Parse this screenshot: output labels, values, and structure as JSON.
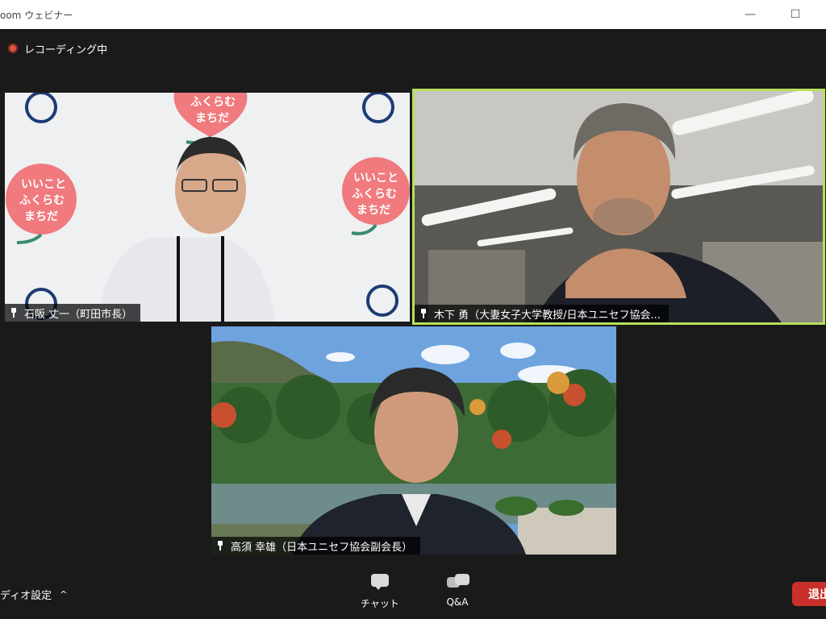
{
  "window": {
    "title": "oom ウェビナー",
    "minimize": "—",
    "maximize": "☐"
  },
  "recording": {
    "label": "レコーディング中"
  },
  "participants": [
    {
      "name": "石阪 丈一（町田市長）"
    },
    {
      "name": "木下 勇（大妻女子大学教授/日本ユニセフ協会..."
    },
    {
      "name": "高須 幸雄（日本ユニセフ協会副会長）"
    }
  ],
  "backdrop": {
    "slogan_line1": "いいこと",
    "slogan_line2": "ふくらむ",
    "slogan_line3": "まちだ"
  },
  "toolbar": {
    "audio_settings": "ディオ設定",
    "chat": "チャット",
    "qa": "Q&A",
    "leave": "退出"
  },
  "colors": {
    "active_speaker_border": "#b7e05a",
    "leave_button": "#c9302c",
    "recording_dot": "#e0553d"
  }
}
